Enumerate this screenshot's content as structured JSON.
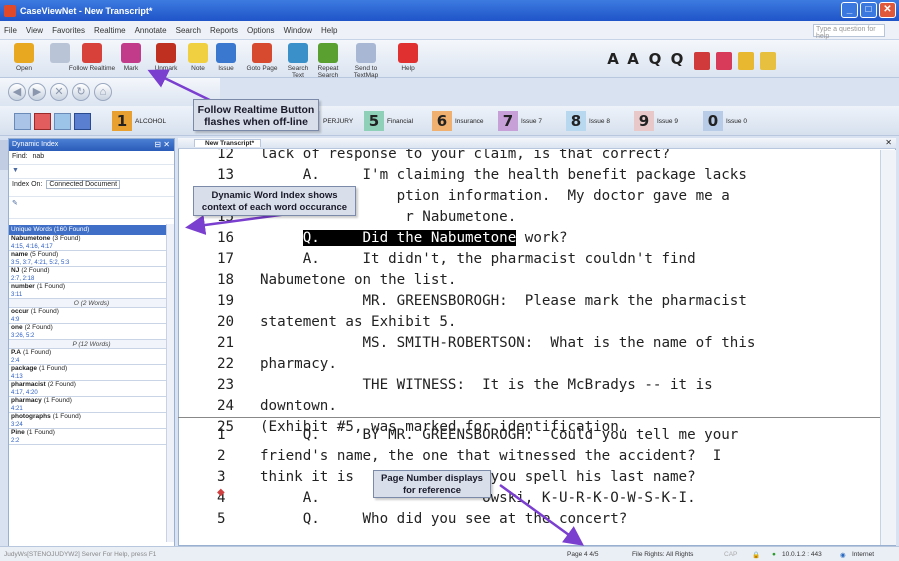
{
  "window": {
    "title": "CaseViewNet - New Transcript*"
  },
  "menu": [
    "File",
    "View",
    "Favorites",
    "Realtime",
    "Annotate",
    "Search",
    "Reports",
    "Options",
    "Window",
    "Help"
  ],
  "help_placeholder": "Type a question for help",
  "toolbar": [
    {
      "label": "Open",
      "icon": "folder-icon",
      "color": "#e8a820"
    },
    {
      "label": "",
      "icon": "document-icon",
      "color": "#b9c4d6"
    },
    {
      "label": "Follow Realtime",
      "icon": "follow-realtime-icon",
      "color": "#d8403a"
    },
    {
      "label": "Mark",
      "icon": "mark-icon",
      "color": "#c23a8a"
    },
    {
      "label": "Unmark",
      "icon": "unmark-icon",
      "color": "#c03020"
    },
    {
      "label": "Note",
      "icon": "note-icon",
      "color": "#f0d040"
    },
    {
      "label": "Issue",
      "icon": "issue-icon",
      "color": "#3a78d0"
    },
    {
      "label": "Goto Page",
      "icon": "goto-page-icon",
      "color": "#d84a30"
    },
    {
      "label": "Search Text",
      "icon": "search-text-icon",
      "color": "#3a90c8"
    },
    {
      "label": "Repeat Search",
      "icon": "repeat-search-icon",
      "color": "#5aa030"
    },
    {
      "label": "Send to TextMap",
      "icon": "textmap-icon",
      "color": "#a8b8d4"
    },
    {
      "label": "Help",
      "icon": "help-icon",
      "color": "#e03030"
    }
  ],
  "font_tools": [
    "A",
    "A",
    "Q",
    "Q"
  ],
  "issues": [
    {
      "num": "1",
      "label": "ALCOHOL",
      "color": "#e8a030"
    },
    {
      "num": "",
      "label": "",
      "color": ""
    },
    {
      "num": "4",
      "label": "PERJURY",
      "color": "#d6dee8"
    },
    {
      "num": "5",
      "label": "Financial",
      "color": "#8fd0b8"
    },
    {
      "num": "6",
      "label": "Insurance",
      "color": "#f0b070"
    },
    {
      "num": "7",
      "label": "Issue 7",
      "color": "#c8a0d8"
    },
    {
      "num": "8",
      "label": "Issue 8",
      "color": "#b8d8f0"
    },
    {
      "num": "9",
      "label": "Issue 9",
      "color": "#e8c8c8"
    },
    {
      "num": "0",
      "label": "Issue 0",
      "color": "#b8cce8"
    }
  ],
  "index_panel": {
    "title": "Dynamic Index",
    "find_label": "Find:",
    "find_value": "nab",
    "index_on_label": "Index On:",
    "index_on_value": "Connected Document",
    "list_title": "Unique Words (160 Found)",
    "items": [
      {
        "type": "word",
        "word": "Nabumetone",
        "count": "(3 Found)",
        "pages": "4:15, 4:16, 4:17"
      },
      {
        "type": "word",
        "word": "name",
        "count": "(5 Found)",
        "pages": "3:5, 3:7, 4:21, 5:2, 5:3"
      },
      {
        "type": "word",
        "word": "NJ",
        "count": "(2 Found)",
        "pages": "2:7, 2:18"
      },
      {
        "type": "word",
        "word": "number",
        "count": "(1 Found)",
        "pages": "3:11"
      },
      {
        "type": "group",
        "text": "O (2 Words)"
      },
      {
        "type": "word",
        "word": "occur",
        "count": "(1 Found)",
        "pages": "4:9"
      },
      {
        "type": "word",
        "word": "one",
        "count": "(2 Found)",
        "pages": "3:26, 5:2"
      },
      {
        "type": "group",
        "text": "P (12 Words)"
      },
      {
        "type": "word",
        "word": "P.A",
        "count": "(1 Found)",
        "pages": "2:4"
      },
      {
        "type": "word",
        "word": "package",
        "count": "(1 Found)",
        "pages": "4:13"
      },
      {
        "type": "word",
        "word": "pharmacist",
        "count": "(2 Found)",
        "pages": "4:17, 4:20"
      },
      {
        "type": "word",
        "word": "pharmacy",
        "count": "(1 Found)",
        "pages": "4:21"
      },
      {
        "type": "word",
        "word": "photographs",
        "count": "(1 Found)",
        "pages": "3:24"
      },
      {
        "type": "word",
        "word": "Pine",
        "count": "(1 Found)",
        "pages": "2:2"
      }
    ]
  },
  "doc_tab": "New Transcript*",
  "transcript_top": [
    {
      "n": "12",
      "t": "lack of response to your claim, is that correct?"
    },
    {
      "n": "13",
      "t": "     A.     I'm claiming the health benefit package lacks"
    },
    {
      "n": "14",
      "t": "                ption information.  My doctor gave me a"
    },
    {
      "n": "15",
      "t": "                 r Nabumetone."
    },
    {
      "n": "16",
      "t": "     Q.     Did the Nabumetone work?"
    },
    {
      "n": "17",
      "t": "     A.     It didn't, the pharmacist couldn't find"
    },
    {
      "n": "18",
      "t": "Nabumetone on the list."
    },
    {
      "n": "19",
      "t": "            MR. GREENSBOROGH:  Please mark the pharmacist"
    },
    {
      "n": "20",
      "t": "statement as Exhibit 5."
    },
    {
      "n": "21",
      "t": "            MS. SMITH-ROBERTSON:  What is the name of this"
    },
    {
      "n": "22",
      "t": "pharmacy."
    },
    {
      "n": "23",
      "t": "            THE WITNESS:  It is the McBradys -- it is"
    },
    {
      "n": "24",
      "t": "downtown."
    },
    {
      "n": "25",
      "t": "(Exhibit #5, was marked for identification."
    }
  ],
  "transcript_bottom": [
    {
      "n": "1",
      "t": "     Q.     BY MR. GREENSBOROGH:  Could you tell me your"
    },
    {
      "n": "2",
      "t": "friend's name, the one that witnessed the accident?  I"
    },
    {
      "n": "3",
      "t": "think it is                you spell his last name?"
    },
    {
      "n": "4",
      "t": "     A.                   owski, K-U-R-K-O-W-S-K-I."
    },
    {
      "n": "5",
      "t": "     Q.     Who did you see at the concert?"
    }
  ],
  "callouts": {
    "follow": "Follow Realtime Button flashes when off-line",
    "index": "Dynamic Word Index shows context of each word occurance",
    "page": "Page Number displays for reference"
  },
  "status": {
    "left": "JudyWs[STENOJUDYW2] Server For Help, press F1",
    "page": "Page 4  4/5",
    "rights": "File Rights: All Rights",
    "caps": "CAP",
    "ip": "10.0.1.2 : 443",
    "zone": "Internet"
  }
}
